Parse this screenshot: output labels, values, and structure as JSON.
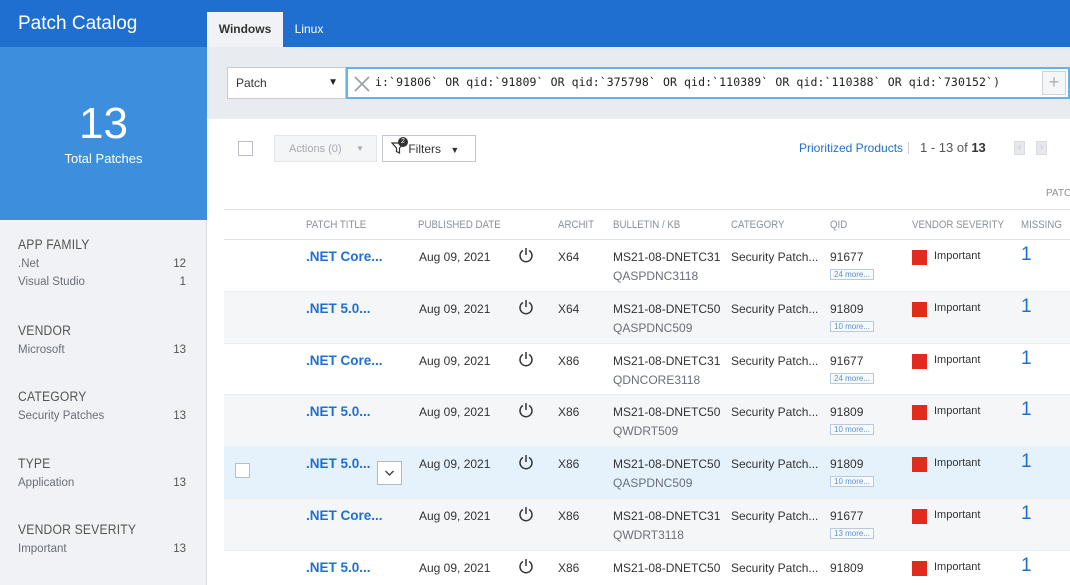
{
  "sidebar": {
    "title": "Patch Catalog",
    "total_count": "13",
    "total_label": "Total Patches",
    "facets": [
      {
        "title": "APP FAMILY",
        "items": [
          {
            "label": ".Net",
            "count": "12"
          },
          {
            "label": "Visual Studio",
            "count": "1"
          }
        ]
      },
      {
        "title": "VENDOR",
        "items": [
          {
            "label": "Microsoft",
            "count": "13"
          }
        ]
      },
      {
        "title": "CATEGORY",
        "items": [
          {
            "label": "Security Patches",
            "count": "13"
          }
        ]
      },
      {
        "title": "TYPE",
        "items": [
          {
            "label": "Application",
            "count": "13"
          }
        ]
      },
      {
        "title": "VENDOR SEVERITY",
        "items": [
          {
            "label": "Important",
            "count": "13"
          }
        ]
      }
    ]
  },
  "tabs": {
    "windows": "Windows",
    "linux": "Linux"
  },
  "query": {
    "type": "Patch",
    "text": "i:`91806` OR qid:`91809` OR qid:`375798` OR qid:`110389` OR qid:`110388` OR qid:`730152`)"
  },
  "toolbar": {
    "actions": "Actions (0)",
    "filters": "Filters",
    "filter_badge": "2",
    "prioritized": "Prioritized Products",
    "pager_range": "1 - 13 of",
    "pager_total": "13",
    "patch_col_truncated": "PATCH"
  },
  "columns": {
    "title": "PATCH TITLE",
    "published": "PUBLISHED DATE",
    "arch": "ARCHIT",
    "bulletin": "BULLETIN / KB",
    "category": "CATEGORY",
    "qid": "QID",
    "severity": "VENDOR SEVERITY",
    "missing": "MISSING"
  },
  "rows": [
    {
      "title": ".NET Core...",
      "date": "Aug 09, 2021",
      "arch": "X64",
      "bulletin": "MS21-08-DNETC31",
      "kb": "QASPDNC3118",
      "category": "Security Patch...",
      "qid": "91677",
      "more": "24 more...",
      "severity": "Important",
      "missing": "1"
    },
    {
      "title": ".NET 5.0...",
      "date": "Aug 09, 2021",
      "arch": "X64",
      "bulletin": "MS21-08-DNETC50",
      "kb": "QASPDNC509",
      "category": "Security Patch...",
      "qid": "91809",
      "more": "10 more...",
      "severity": "Important",
      "missing": "1"
    },
    {
      "title": ".NET Core...",
      "date": "Aug 09, 2021",
      "arch": "X86",
      "bulletin": "MS21-08-DNETC31",
      "kb": "QDNCORE3118",
      "category": "Security Patch...",
      "qid": "91677",
      "more": "24 more...",
      "severity": "Important",
      "missing": "1"
    },
    {
      "title": ".NET 5.0...",
      "date": "Aug 09, 2021",
      "arch": "X86",
      "bulletin": "MS21-08-DNETC50",
      "kb": "QWDRT509",
      "category": "Security Patch...",
      "qid": "91809",
      "more": "10 more...",
      "severity": "Important",
      "missing": "1"
    },
    {
      "title": ".NET 5.0...",
      "date": "Aug 09, 2021",
      "arch": "X86",
      "bulletin": "MS21-08-DNETC50",
      "kb": "QASPDNC509",
      "category": "Security Patch...",
      "qid": "91809",
      "more": "10 more...",
      "severity": "Important",
      "missing": "1"
    },
    {
      "title": ".NET Core...",
      "date": "Aug 09, 2021",
      "arch": "X86",
      "bulletin": "MS21-08-DNETC31",
      "kb": "QWDRT3118",
      "category": "Security Patch...",
      "qid": "91677",
      "more": "13 more...",
      "severity": "Important",
      "missing": "1"
    },
    {
      "title": ".NET 5.0...",
      "date": "Aug 09, 2021",
      "arch": "X86",
      "bulletin": "MS21-08-DNETC50",
      "kb": "",
      "category": "Security Patch...",
      "qid": "91809",
      "more": "",
      "severity": "Important",
      "missing": "1"
    }
  ],
  "colors": {
    "brand": "#1f6fd1",
    "severity_important": "#e02b1d",
    "highlight_row": "#e5f2fc"
  }
}
